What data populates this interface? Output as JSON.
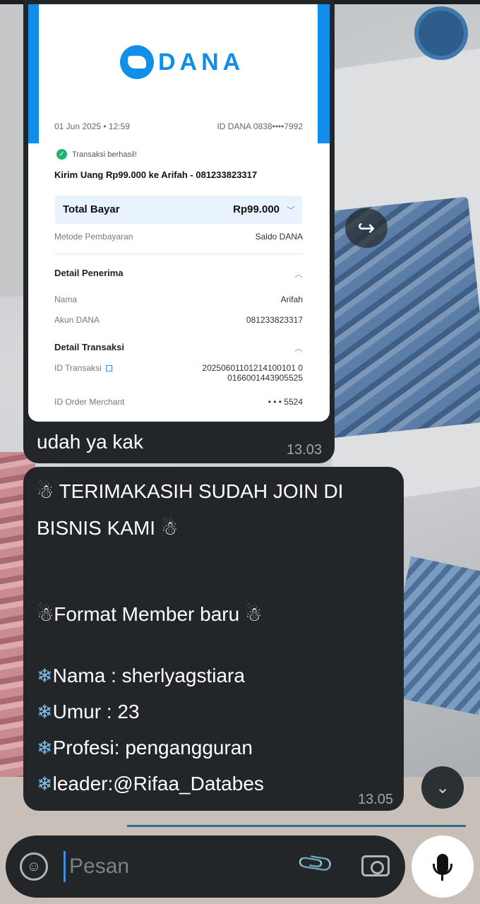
{
  "receipt": {
    "brand": "DANA",
    "date": "01 Jun 2025 • 12:59",
    "id_dana": "ID DANA 0838••••7992",
    "status": "Transaksi berhasil!",
    "title": "Kirim Uang Rp99.000 ke Arifah - 081233823317",
    "total_label": "Total Bayar",
    "total_value": "Rp99.000",
    "method_label": "Metode Pembayaran",
    "method_value": "Saldo DANA",
    "recipient_section": "Detail Penerima",
    "name_label": "Nama",
    "name_value": "Arifah",
    "account_label": "Akun DANA",
    "account_value": "081233823317",
    "transaction_section": "Detail Transaksi",
    "trx_id_label": "ID Transaksi",
    "trx_id_value_1": "20250601101214100101 0",
    "trx_id_value_2": "0166001443905525",
    "merchant_label": "ID Order Merchant",
    "merchant_value": "• • • 5524"
  },
  "message1": {
    "text": "udah ya kak",
    "time": "13.03"
  },
  "message2": {
    "line1": "TERIMAKASIH SUDAH JOIN DI",
    "line2": "BISNIS KAMI",
    "line3": "Format Member baru",
    "line4": "Nama : sherlyagstiara",
    "line5": "Umur : 23",
    "line6": "Profesi: pengangguran",
    "line7": "leader:@Rifaa_Databes",
    "time": "13.05",
    "snowman_emoji": "☃",
    "snowflake_emoji": "❄"
  },
  "input": {
    "placeholder": "Pesan"
  },
  "icons": {
    "forward": "↪",
    "scroll_down": "⌄",
    "sticker": "☺",
    "attach": "📎"
  },
  "colors": {
    "bubble": "#222629",
    "dana_blue": "#118eea",
    "timestamp": "#a0a6ab"
  }
}
